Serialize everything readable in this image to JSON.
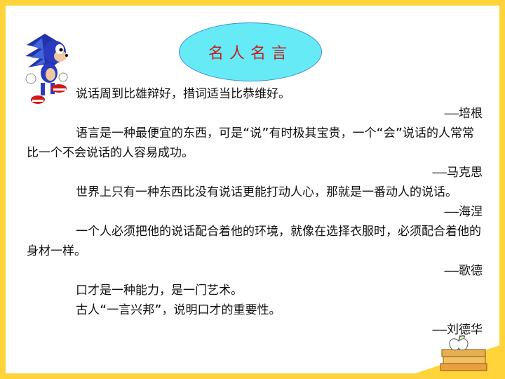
{
  "title": "名人名言",
  "quotes": [
    {
      "text": "说话周到比雄辩好，措词适当比恭维好。",
      "author": "——培根"
    },
    {
      "text": "语言是一种最便宜的东西，可是“说”有时极其宝贵，一个“会”说话的人常常比一个不会说话的人容易成功。",
      "author": "——马克思"
    },
    {
      "text": "世界上只有一种东西比没有说话更能打动人心，那就是一番动人的说话。",
      "author": "——海涅"
    },
    {
      "text": "一个人必须把他的说话配合着他的环境，就像在选择衣服时，必须配合着他的身材一样。",
      "author": "——歌德"
    },
    {
      "text": "口才是一种能力，是一门艺术。",
      "text2": "古人“一言兴邦”，说明口才的重要性。",
      "author": "——刘德华"
    }
  ],
  "colors": {
    "border": "#ffd33a",
    "oval": "#66eaf6",
    "title": "#c02020"
  },
  "icons": {
    "mascot": "sonic-hedgehog-icon",
    "decor": "books-apple-icon"
  }
}
